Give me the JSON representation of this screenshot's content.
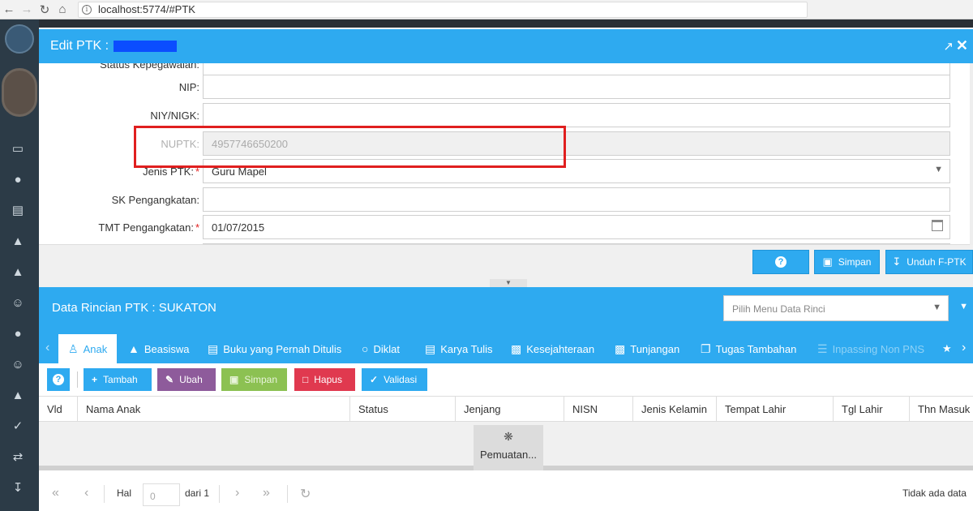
{
  "browser": {
    "url": "localhost:5774/#PTK"
  },
  "modal": {
    "title": "Edit PTK :",
    "fields": [
      {
        "label": "Status Kepegawaian:",
        "value": ""
      },
      {
        "label": "NIP:",
        "value": ""
      },
      {
        "label": "NIY/NIGK:",
        "value": ""
      },
      {
        "label": "NUPTK:",
        "value": "4957746650200"
      },
      {
        "label": "Jenis PTK:",
        "value": "Guru Mapel",
        "required": "*"
      },
      {
        "label": "SK Pengangkatan:",
        "value": ""
      },
      {
        "label": "TMT Pengangkatan:",
        "value": "01/07/2015",
        "required": "*"
      }
    ],
    "buttons": {
      "help": "?",
      "save": "Simpan",
      "download": "Unduh F-PTK"
    }
  },
  "panel": {
    "title": "Data Rincian PTK : SUKATON",
    "select_placeholder": "Pilih Menu Data Rinci",
    "tabs": [
      {
        "label": "Anak",
        "icon": "child-icon"
      },
      {
        "label": "Beasiswa",
        "icon": "graduation-cap-icon"
      },
      {
        "label": "Buku yang Pernah Ditulis",
        "icon": "book-icon"
      },
      {
        "label": "Diklat",
        "icon": "lightbulb-icon"
      },
      {
        "label": "Karya Tulis",
        "icon": "book-icon"
      },
      {
        "label": "Kesejahteraan",
        "icon": "money-icon"
      },
      {
        "label": "Tunjangan",
        "icon": "money-icon"
      },
      {
        "label": "Tugas Tambahan",
        "icon": "files-icon"
      },
      {
        "label": "Inpassing Non PNS",
        "icon": "list-icon"
      }
    ],
    "toolbar": {
      "help": "?",
      "add": "Tambah",
      "edit": "Ubah",
      "save": "Simpan",
      "delete": "Hapus",
      "validate": "Validasi"
    },
    "columns": [
      "Vld",
      "Nama Anak",
      "Status",
      "Jenjang",
      "NISN",
      "Jenis Kelamin",
      "Tempat Lahir",
      "Tgl Lahir",
      "Thn Masuk"
    ],
    "loading_text": "Pemuatan...",
    "pager": {
      "hal_label": "Hal",
      "page_value": "0",
      "of_label": "dari 1",
      "status": "Tidak ada data"
    }
  },
  "colors": {
    "primary": "#2eaaf0",
    "add": "#2eaaf0",
    "edit": "#8e5b9b",
    "save": "#8cc152",
    "delete": "#e0394f",
    "validate": "#2eaaf0",
    "highlight": "#e01f1f"
  }
}
